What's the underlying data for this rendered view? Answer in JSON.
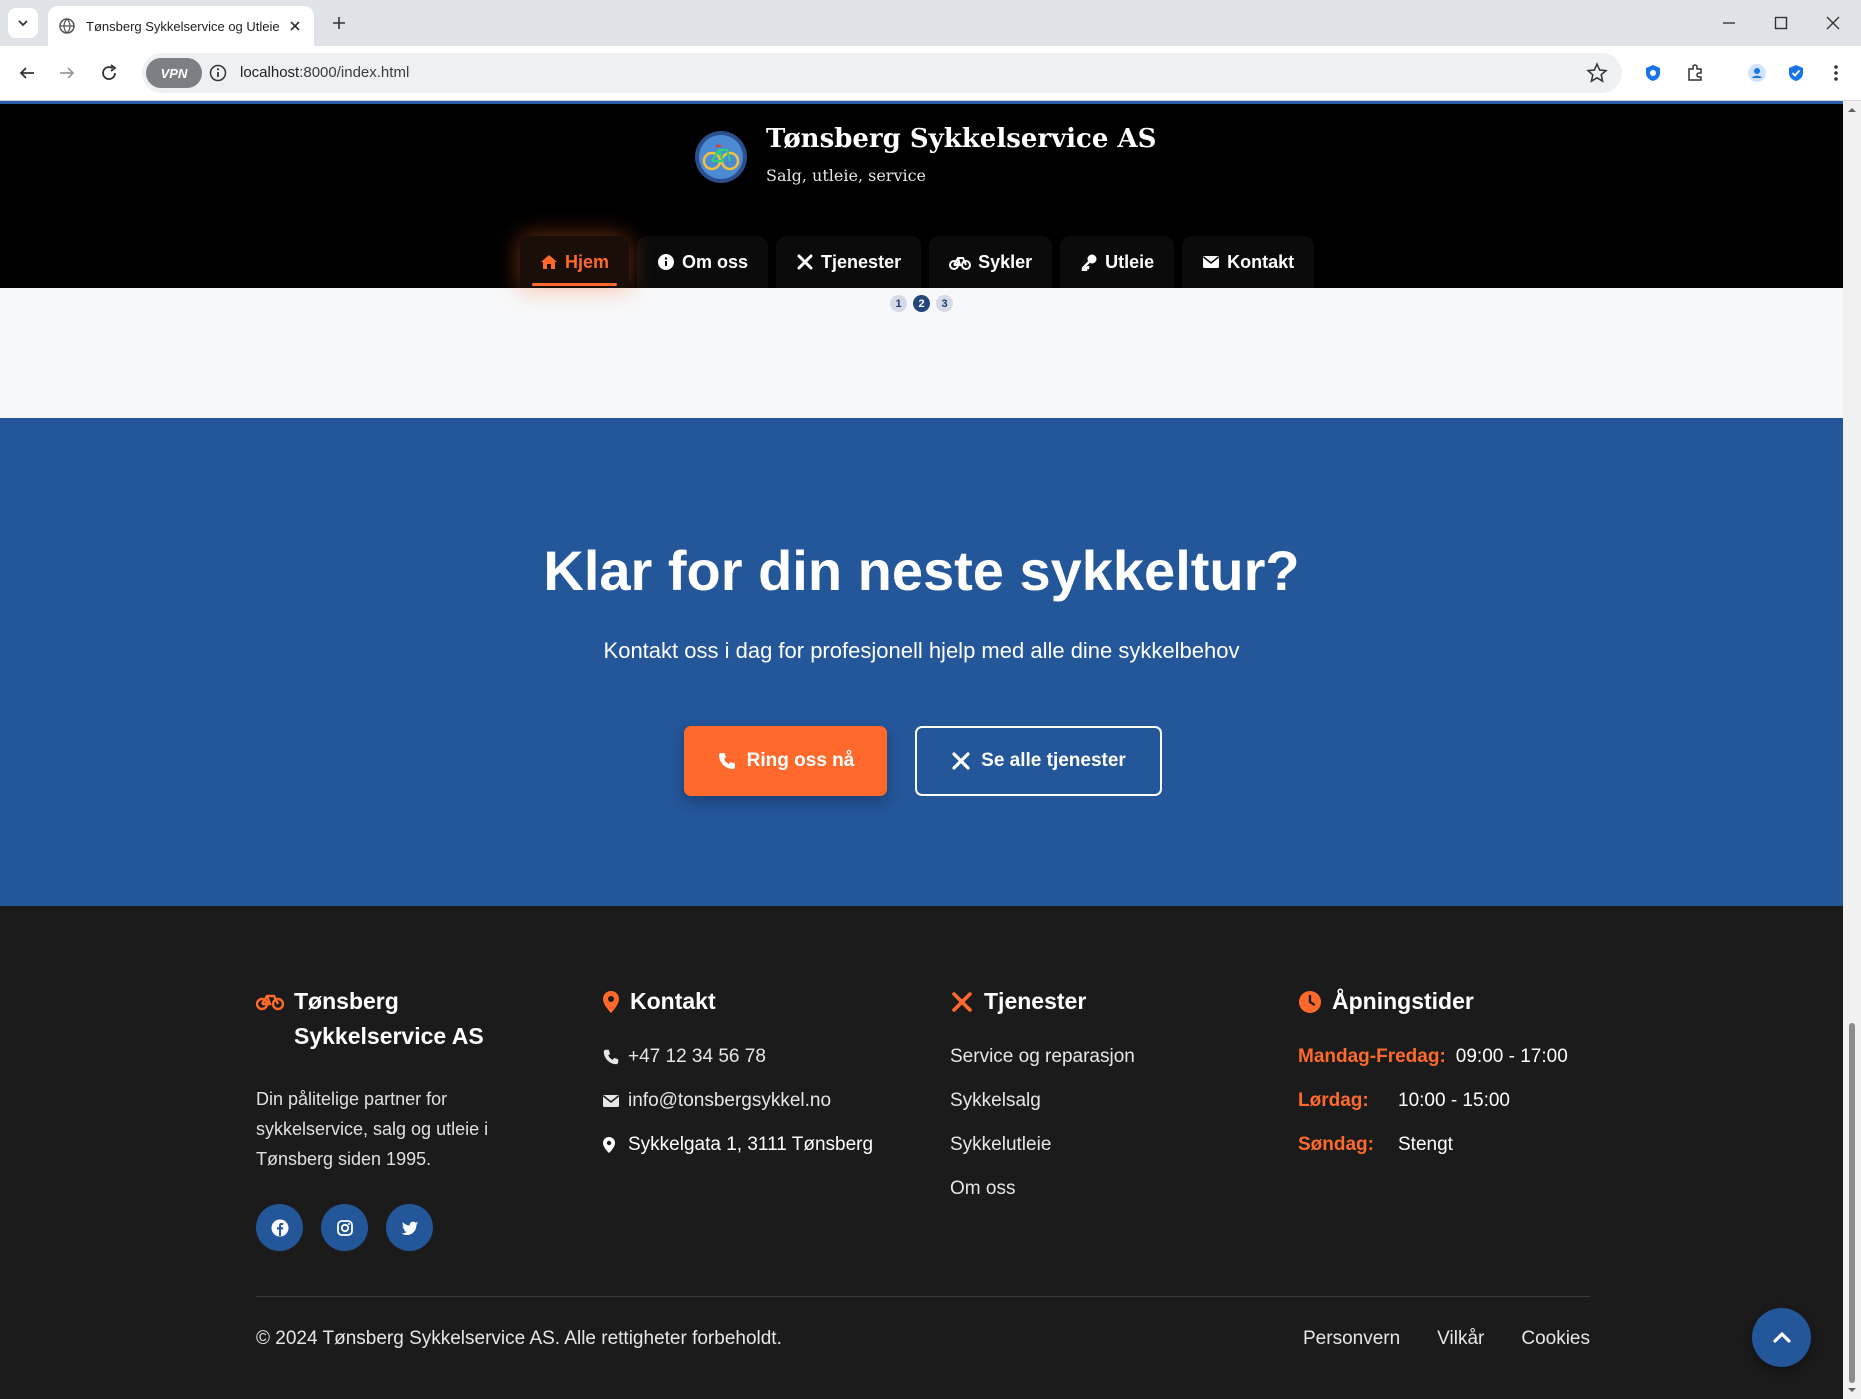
{
  "browser": {
    "tab_title": "Tønsberg Sykkelservice og Utleie AS",
    "url_host": "localhost",
    "url_rest": ":8000/index.html",
    "vpn_label": "VPN"
  },
  "header": {
    "brand_name": "Tønsberg Sykkelservice AS",
    "brand_tagline": "Salg, utleie, service",
    "nav": [
      {
        "label": "Hjem",
        "icon": "home-icon",
        "active": true
      },
      {
        "label": "Om oss",
        "icon": "info-icon"
      },
      {
        "label": "Tjenester",
        "icon": "tools-icon"
      },
      {
        "label": "Sykler",
        "icon": "bicycle-icon"
      },
      {
        "label": "Utleie",
        "icon": "key-icon"
      },
      {
        "label": "Kontakt",
        "icon": "envelope-icon"
      }
    ]
  },
  "slider": {
    "dots": [
      "1",
      "2",
      "3"
    ],
    "active_index": 1
  },
  "cta": {
    "title": "Klar for din neste sykkeltur?",
    "subtitle": "Kontakt oss i dag for profesjonell hjelp med alle dine sykkelbehov",
    "primary_button": "Ring oss nå",
    "secondary_button": "Se alle tjenester"
  },
  "footer": {
    "about": {
      "title_line1": "Tønsberg",
      "title_line2": "Sykkelservice AS",
      "description": "Din pålitelige partner for sykkelservice, salg og utleie i Tønsberg siden 1995.",
      "social": [
        "facebook-icon",
        "instagram-icon",
        "twitter-icon"
      ]
    },
    "contact": {
      "title": "Kontakt",
      "phone": "+47 12 34 56 78",
      "email": "info@tonsbergsykkel.no",
      "address": "Sykkelgata 1, 3111 Tønsberg"
    },
    "services": {
      "title": "Tjenester",
      "links": [
        "Service og reparasjon",
        "Sykkelsalg",
        "Sykkelutleie",
        "Om oss"
      ]
    },
    "hours": {
      "title": "Åpningstider",
      "rows": [
        {
          "day": "Mandag-Fredag:",
          "time": "09:00 - 17:00"
        },
        {
          "day": "Lørdag:",
          "time": "10:00 - 15:00"
        },
        {
          "day": "Søndag:",
          "time": "Stengt"
        }
      ]
    },
    "copyright": "© 2024 Tønsberg Sykkelservice AS. Alle rettigheter forbeholdt.",
    "legal_links": [
      "Personvern",
      "Vilkår",
      "Cookies"
    ]
  },
  "colors": {
    "accent": "#ff6a2c",
    "brand_blue": "#24569a",
    "footer_bg": "#1b1b1b",
    "header_bg": "#000000"
  }
}
